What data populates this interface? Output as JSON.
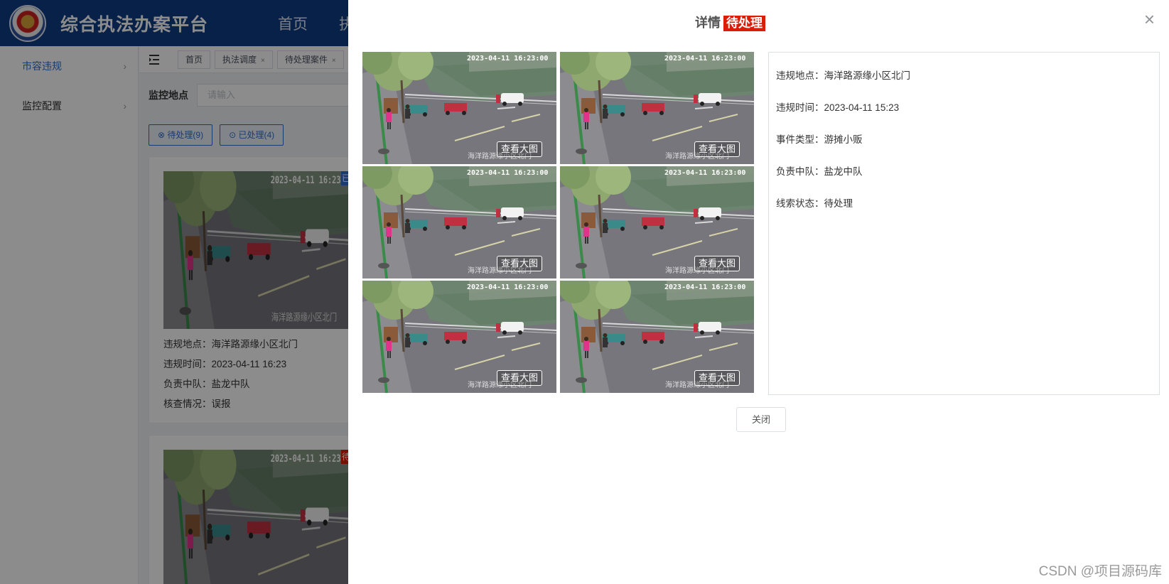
{
  "app": {
    "title": "综合执法办案平台",
    "nav": [
      "首页",
      "执法"
    ]
  },
  "sidebar": {
    "items": [
      {
        "label": "市容违规",
        "active": true
      },
      {
        "label": "监控配置",
        "active": false
      }
    ]
  },
  "tabs": [
    {
      "label": "首页",
      "closable": false
    },
    {
      "label": "执法调度",
      "closable": true
    },
    {
      "label": "待处理案件",
      "closable": true
    }
  ],
  "search": {
    "label": "监控地点",
    "placeholder": "请输入"
  },
  "filters": [
    {
      "icon": "circle-x-icon",
      "label": "待处理(9)"
    },
    {
      "icon": "circle-check-icon",
      "label": "已处理(4)"
    }
  ],
  "cards": [
    {
      "badge": "已",
      "badge_color": "#2f6ccb",
      "lines": [
        "违规地点：海洋路源缘小区北门",
        "违规时间：2023-04-11 16:23",
        "负责中队：盐龙中队",
        "核查情况：误报"
      ]
    },
    {
      "badge": "待",
      "badge_color": "#d81e06",
      "lines": []
    }
  ],
  "camera": {
    "timestamp": "2023-04-11  16:23:00",
    "timestamp_small": "2023-04-11  1",
    "location_caption": "海洋路源缘小区北门"
  },
  "drawer": {
    "title": "详情",
    "status": "待处理",
    "status_color": "#d81e06",
    "view_button": "查看大图",
    "details": [
      {
        "label": "违规地点：",
        "value": "海洋路源缘小区北门"
      },
      {
        "label": "违规时间：",
        "value": "2023-04-11 15:23"
      },
      {
        "label": "事件类型：",
        "value": "游摊小贩"
      },
      {
        "label": "负责中队：",
        "value": "盐龙中队"
      },
      {
        "label": "线索状态：",
        "value": "待处理"
      }
    ],
    "close_button": "关闭"
  },
  "watermark": "CSDN @项目源码库"
}
